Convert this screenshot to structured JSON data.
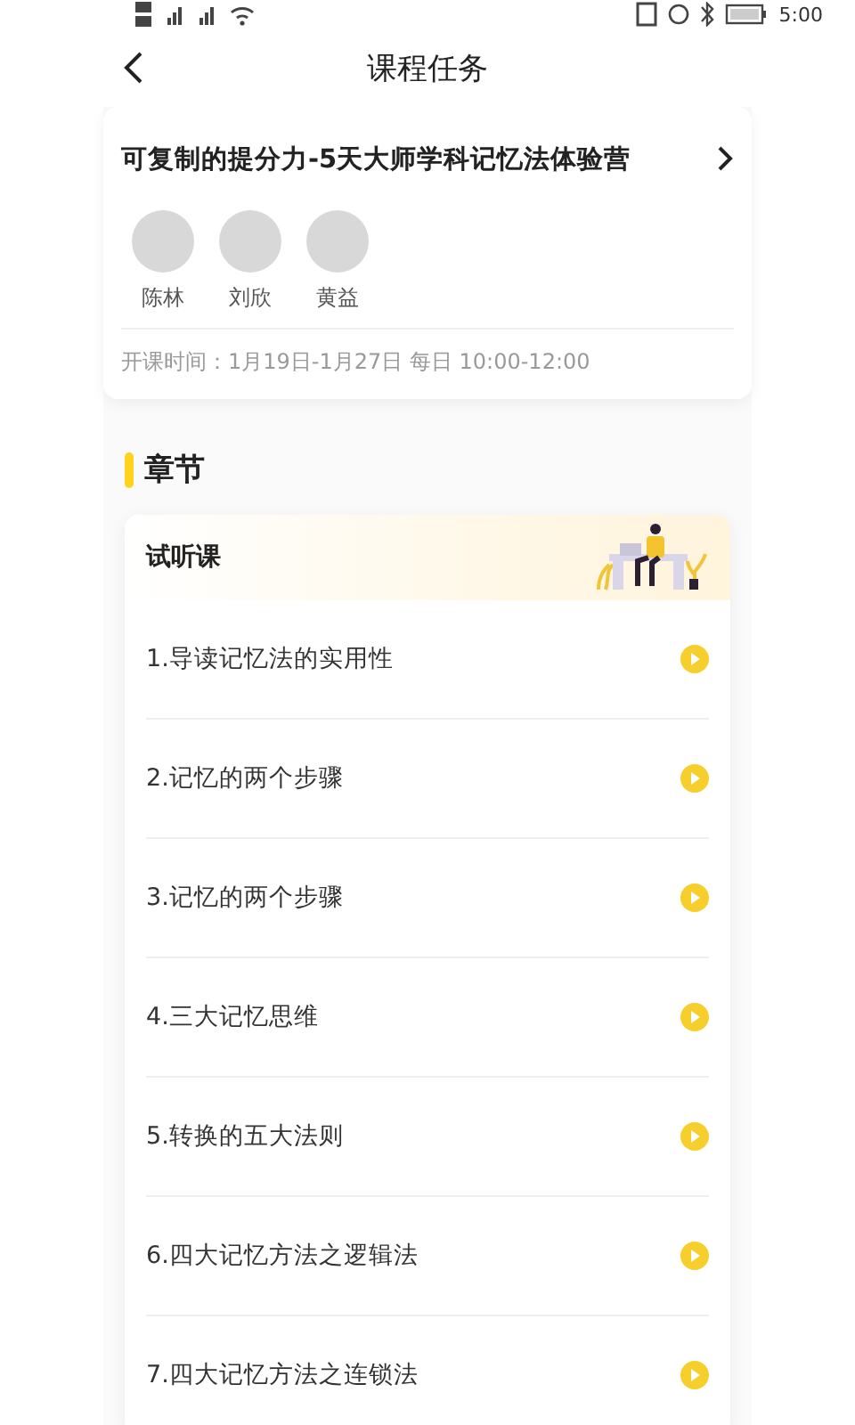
{
  "status_bar": {
    "time": "5:00"
  },
  "nav": {
    "title": "课程任务"
  },
  "course": {
    "title": "可复制的提分力-5天大师学科记忆法体验营",
    "teachers": [
      {
        "name": "陈林"
      },
      {
        "name": "刘欣"
      },
      {
        "name": "黄益"
      }
    ],
    "schedule": "开课时间：1月19日-1月27日 每日 10:00-12:00"
  },
  "section": {
    "title": "章节"
  },
  "chapter": {
    "title": "试听课",
    "lessons": [
      {
        "title": "1.导读记忆法的实用性"
      },
      {
        "title": "2.记忆的两个步骤"
      },
      {
        "title": "3.记忆的两个步骤"
      },
      {
        "title": "4.三大记忆思维"
      },
      {
        "title": "5.转换的五大法则"
      },
      {
        "title": "6.四大记忆方法之逻辑法"
      },
      {
        "title": "7.四大记忆方法之连锁法"
      }
    ]
  }
}
